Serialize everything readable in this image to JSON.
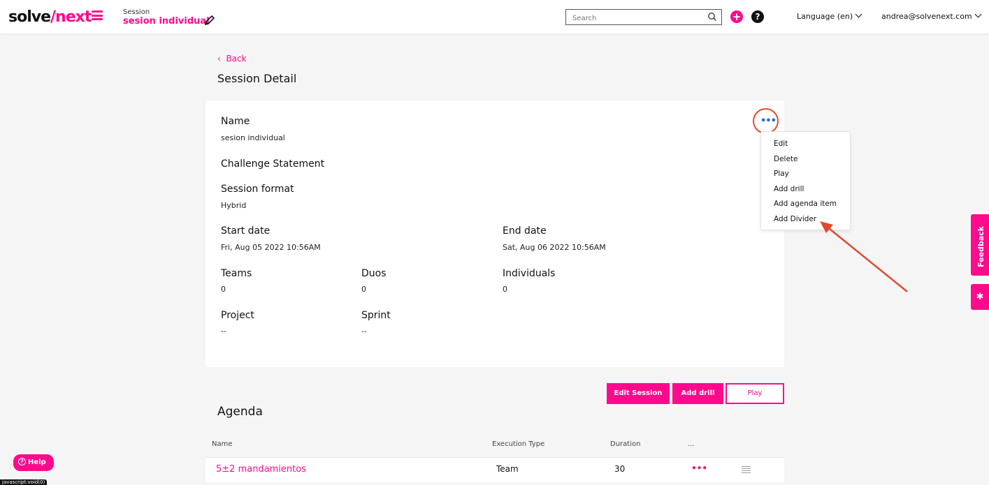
{
  "header": {
    "logo_part1": "solve",
    "logo_part2": "/next",
    "session_label": "Session",
    "session_name": "sesion individual",
    "search_placeholder": "Search",
    "language": "Language (en)",
    "user_email": "andrea@solvenext.com"
  },
  "page": {
    "back_label": "Back",
    "title": "Session Detail"
  },
  "details": {
    "name_label": "Name",
    "name_value": "sesion individual",
    "challenge_label": "Challenge Statement",
    "format_label": "Session format",
    "format_value": "Hybrid",
    "start_label": "Start date",
    "start_value": "Fri, Aug 05 2022 10:56AM",
    "end_label": "End date",
    "end_value": "Sat, Aug 06 2022 10:56AM",
    "teams_label": "Teams",
    "teams_value": "0",
    "duos_label": "Duos",
    "duos_value": "0",
    "individuals_label": "Individuals",
    "individuals_value": "0",
    "project_label": "Project",
    "project_value": "--",
    "sprint_label": "Sprint",
    "sprint_value": "--"
  },
  "more_menu": {
    "trigger": "•••",
    "items": [
      "Edit",
      "Delete",
      "Play",
      "Add drill",
      "Add agenda item",
      "Add Divider"
    ]
  },
  "actions": {
    "edit_session": "Edit Session",
    "add_drill": "Add drill",
    "play": "Play"
  },
  "agenda": {
    "title": "Agenda",
    "columns": [
      "Name",
      "Execution Type",
      "Duration",
      "..."
    ],
    "rows": [
      {
        "name": "5±2 mandamientos",
        "execution_type": "Team",
        "duration": "30",
        "actions": "•••"
      }
    ]
  },
  "side_tabs": {
    "feedback": "Feedback"
  },
  "help_button": "Help",
  "status_text": "javascript:void(0)",
  "colors": {
    "brand": "#ff0a8c",
    "annotation": "#e04a2f",
    "dots_blue": "#1f6fd6"
  },
  "icons": [
    "hamburger-icon",
    "pencil-icon",
    "search-icon",
    "plus-circle-icon",
    "question-circle-icon",
    "chevron-down-icon",
    "more-horizontal-icon",
    "bug-icon",
    "drag-handle-icon"
  ]
}
